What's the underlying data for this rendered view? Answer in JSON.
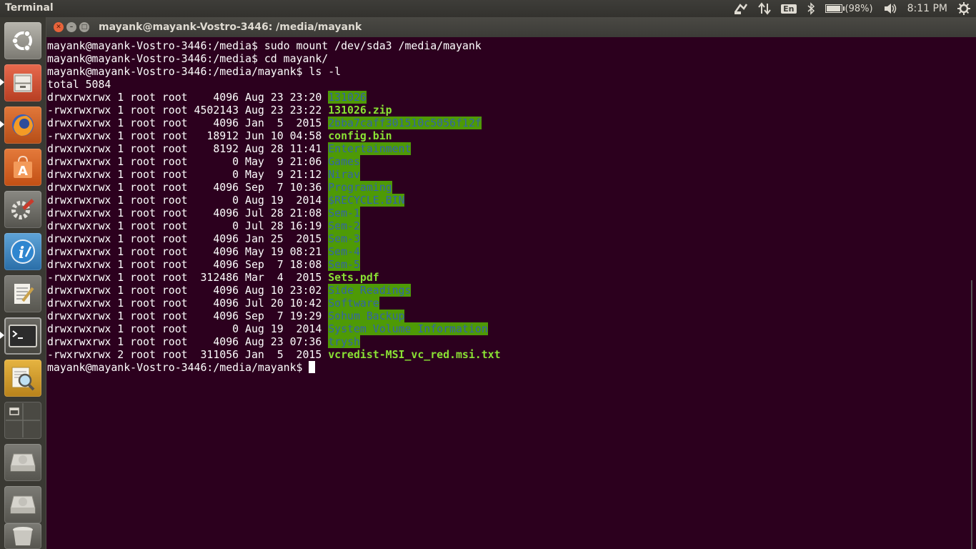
{
  "panel": {
    "app_title": "Terminal",
    "keyboard_layout": "En",
    "battery": "(98%)",
    "battery_level": 0.98,
    "clock": "8:11 PM"
  },
  "launcher": {
    "items": [
      {
        "name": "dash-home",
        "icon": "ubuntu-logo-icon"
      },
      {
        "name": "files",
        "icon": "file-cabinet-icon"
      },
      {
        "name": "firefox",
        "icon": "firefox-icon"
      },
      {
        "name": "software-center",
        "icon": "shopping-bag-icon"
      },
      {
        "name": "system-settings",
        "icon": "gear-wrench-icon"
      },
      {
        "name": "software-updater",
        "icon": "info-updater-icon"
      },
      {
        "name": "text-editor",
        "icon": "notepad-pencil-icon"
      },
      {
        "name": "terminal",
        "icon": "terminal-icon"
      },
      {
        "name": "document-viewer",
        "icon": "magnifier-document-icon"
      },
      {
        "name": "workspace-switcher",
        "icon": "workspaces-icon"
      },
      {
        "name": "drive-1",
        "icon": "hard-drive-icon"
      },
      {
        "name": "drive-2",
        "icon": "hard-drive-icon"
      },
      {
        "name": "trash",
        "icon": "trash-icon"
      }
    ]
  },
  "window": {
    "title": "mayank@mayank-Vostro-3446: /media/mayank"
  },
  "terminal": {
    "lines": [
      {
        "prefix": "mayank@mayank-Vostro-3446:/media$ sudo mount /dev/sda3 /media/mayank",
        "name": "",
        "type": "plain"
      },
      {
        "prefix": "mayank@mayank-Vostro-3446:/media$ cd mayank/",
        "name": "",
        "type": "plain"
      },
      {
        "prefix": "mayank@mayank-Vostro-3446:/media/mayank$ ls -l",
        "name": "",
        "type": "plain"
      },
      {
        "prefix": "total 5084",
        "name": "",
        "type": "plain"
      },
      {
        "prefix": "drwxrwxrwx 1 root root    4096 Aug 23 23:20 ",
        "name": "131026",
        "type": "dir"
      },
      {
        "prefix": "-rwxrwxrwx 1 root root 4502143 Aug 23 23:22 ",
        "name": "131026.zip",
        "type": "exe"
      },
      {
        "prefix": "drwxrwxrwx 1 root root    4096 Jan  5  2015 ",
        "name": "2bba7caff301510c5056f12f",
        "type": "dir"
      },
      {
        "prefix": "-rwxrwxrwx 1 root root   18912 Jun 10 04:58 ",
        "name": "config.bin",
        "type": "exe"
      },
      {
        "prefix": "drwxrwxrwx 1 root root    8192 Aug 28 11:41 ",
        "name": "Entertainment",
        "type": "dir"
      },
      {
        "prefix": "drwxrwxrwx 1 root root       0 May  9 21:06 ",
        "name": "Games",
        "type": "dir"
      },
      {
        "prefix": "drwxrwxrwx 1 root root       0 May  9 21:12 ",
        "name": "Nirav",
        "type": "dir"
      },
      {
        "prefix": "drwxrwxrwx 1 root root    4096 Sep  7 10:36 ",
        "name": "Programing",
        "type": "dir"
      },
      {
        "prefix": "drwxrwxrwx 1 root root       0 Aug 19  2014 ",
        "name": "$RECYCLE.BIN",
        "type": "dir"
      },
      {
        "prefix": "drwxrwxrwx 1 root root    4096 Jul 28 21:08 ",
        "name": "Sem-1",
        "type": "dir"
      },
      {
        "prefix": "drwxrwxrwx 1 root root       0 Jul 28 16:19 ",
        "name": "Sem-2",
        "type": "dir"
      },
      {
        "prefix": "drwxrwxrwx 1 root root    4096 Jan 25  2015 ",
        "name": "Sem-3",
        "type": "dir"
      },
      {
        "prefix": "drwxrwxrwx 1 root root    4096 May 19 08:21 ",
        "name": "Sem-4",
        "type": "dir"
      },
      {
        "prefix": "drwxrwxrwx 1 root root    4096 Sep  7 18:08 ",
        "name": "Sem-5",
        "type": "dir"
      },
      {
        "prefix": "-rwxrwxrwx 1 root root  312486 Mar  4  2015 ",
        "name": "Sets.pdf",
        "type": "exe"
      },
      {
        "prefix": "drwxrwxrwx 1 root root    4096 Aug 10 23:02 ",
        "name": "Side Readings",
        "type": "dir"
      },
      {
        "prefix": "drwxrwxrwx 1 root root    4096 Jul 20 10:42 ",
        "name": "Software",
        "type": "dir"
      },
      {
        "prefix": "drwxrwxrwx 1 root root    4096 Sep  7 19:29 ",
        "name": "Sohum Backup",
        "type": "dir"
      },
      {
        "prefix": "drwxrwxrwx 1 root root       0 Aug 19  2014 ",
        "name": "System Volume Information",
        "type": "dir"
      },
      {
        "prefix": "drwxrwxrwx 1 root root    4096 Aug 23 07:36 ",
        "name": "trysh",
        "type": "dir"
      },
      {
        "prefix": "-rwxrwxrwx 2 root root  311056 Jan  5  2015 ",
        "name": "vcredist-MSI_vc_red.msi.txt",
        "type": "exe"
      }
    ],
    "prompt": "mayank@mayank-Vostro-3446:/media/mayank$ "
  }
}
